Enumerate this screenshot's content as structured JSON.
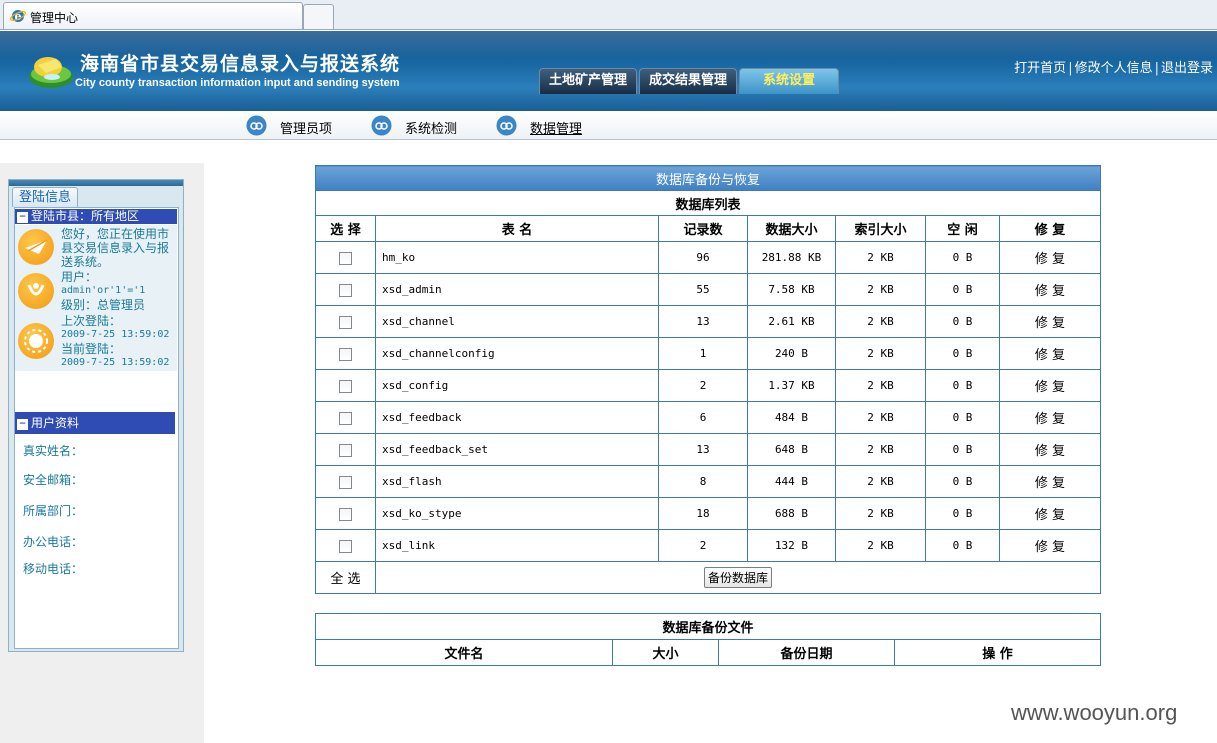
{
  "browser": {
    "tab_title": "管理中心"
  },
  "header": {
    "title": "海南省市县交易信息录入与报送系统",
    "subtitle": "City county transaction information input and sending system",
    "nav_tabs": [
      {
        "label": "土地矿产管理",
        "active": false
      },
      {
        "label": "成交结果管理",
        "active": false
      },
      {
        "label": "系统设置",
        "active": true
      }
    ],
    "links": {
      "home": "打开首页",
      "edit_profile": "修改个人信息",
      "logout": "退出登录"
    }
  },
  "subnav": {
    "items": [
      {
        "label": "管理员项"
      },
      {
        "label": "系统检测"
      },
      {
        "label": "数据管理"
      }
    ]
  },
  "sidebar": {
    "tab_label": "登陆信息",
    "login_section_title": "登陆市县：所有地区",
    "welcome": "您好，您正在使用市县交易信息录入与报送系统。",
    "user_label": "用户：",
    "user_value": "admin'or'1'='1",
    "level": "级别：总管理员",
    "last_login_label": "上次登陆：",
    "last_login_value": "2009-7-25 13:59:02",
    "current_login_label": "当前登陆：",
    "current_login_value": "2009-7-25 13:59:02",
    "profile_section_title": "用户资料",
    "profile_fields": [
      "真实姓名：",
      "安全邮箱：",
      "所属部门：",
      "办公电话：",
      "移动电话："
    ]
  },
  "db_panel": {
    "caption": "数据库备份与恢复",
    "list_title": "数据库列表",
    "columns": [
      "选 择",
      "表 名",
      "记录数",
      "数据大小",
      "索引大小",
      "空 闲",
      "修 复"
    ],
    "rows": [
      {
        "name": "hm_ko",
        "records": "96",
        "data_size": "281.88 KB",
        "index_size": "2 KB",
        "free": "0 B",
        "repair": "修 复"
      },
      {
        "name": "xsd_admin",
        "records": "55",
        "data_size": "7.58 KB",
        "index_size": "2 KB",
        "free": "0 B",
        "repair": "修 复"
      },
      {
        "name": "xsd_channel",
        "records": "13",
        "data_size": "2.61 KB",
        "index_size": "2 KB",
        "free": "0 B",
        "repair": "修 复"
      },
      {
        "name": "xsd_channelconfig",
        "records": "1",
        "data_size": "240 B",
        "index_size": "2 KB",
        "free": "0 B",
        "repair": "修 复"
      },
      {
        "name": "xsd_config",
        "records": "2",
        "data_size": "1.37 KB",
        "index_size": "2 KB",
        "free": "0 B",
        "repair": "修 复"
      },
      {
        "name": "xsd_feedback",
        "records": "6",
        "data_size": "484 B",
        "index_size": "2 KB",
        "free": "0 B",
        "repair": "修 复"
      },
      {
        "name": "xsd_feedback_set",
        "records": "13",
        "data_size": "648 B",
        "index_size": "2 KB",
        "free": "0 B",
        "repair": "修 复"
      },
      {
        "name": "xsd_flash",
        "records": "8",
        "data_size": "444 B",
        "index_size": "2 KB",
        "free": "0 B",
        "repair": "修 复"
      },
      {
        "name": "xsd_ko_stype",
        "records": "18",
        "data_size": "688 B",
        "index_size": "2 KB",
        "free": "0 B",
        "repair": "修 复"
      },
      {
        "name": "xsd_link",
        "records": "2",
        "data_size": "132 B",
        "index_size": "2 KB",
        "free": "0 B",
        "repair": "修 复"
      }
    ],
    "select_all": "全 选",
    "backup_button": "备份数据库"
  },
  "backup_files": {
    "title": "数据库备份文件",
    "columns": [
      "文件名",
      "大小",
      "备份日期",
      "操 作"
    ]
  },
  "watermark": "www.wooyun.org"
}
